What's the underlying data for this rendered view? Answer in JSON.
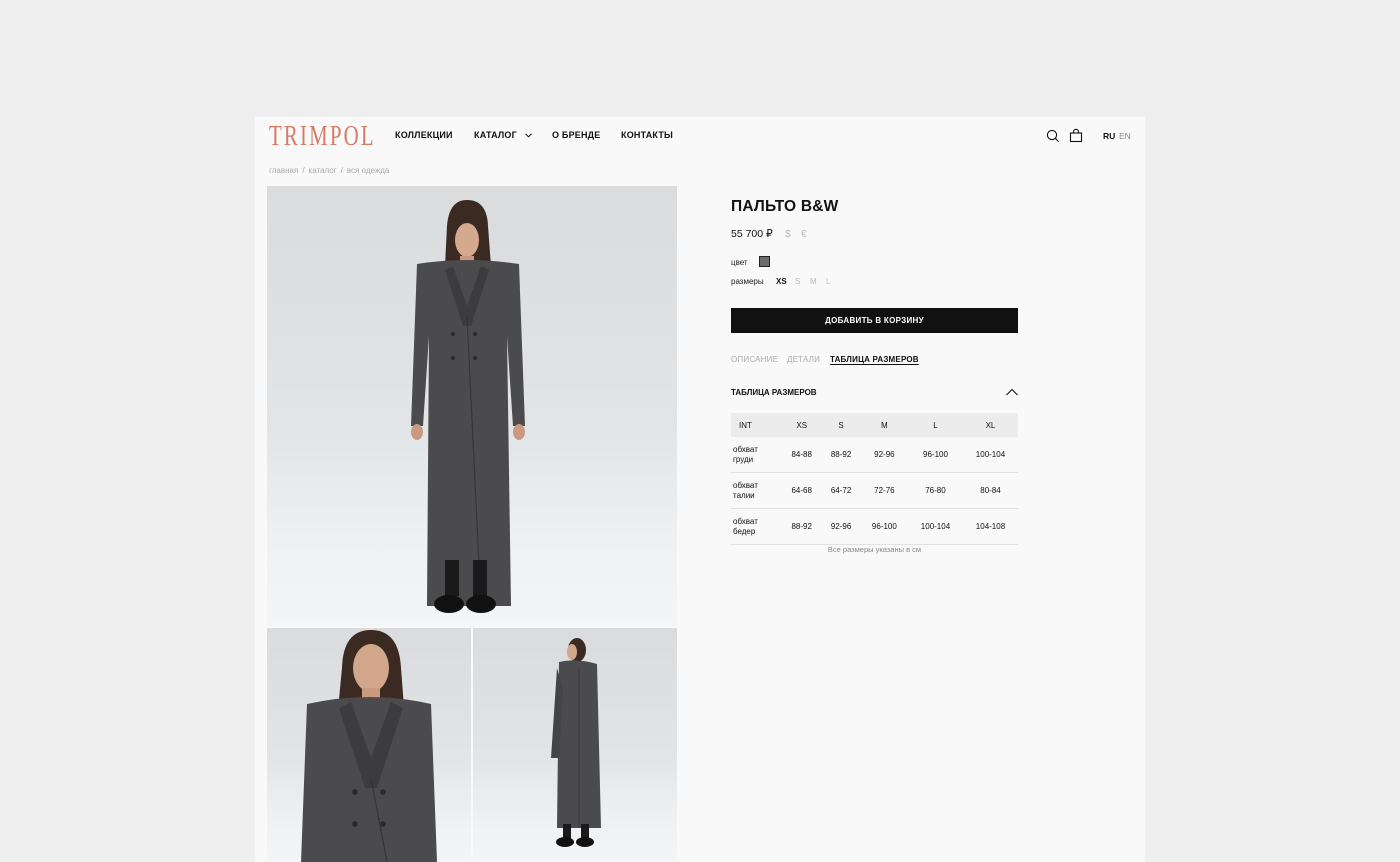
{
  "brand": {
    "logo_text": "TRIMPOL",
    "logo_color": "#d77a66"
  },
  "nav": {
    "collections": "КОЛЛЕКЦИИ",
    "catalog": "КАТАЛОГ",
    "about": "О БРЕНДЕ",
    "contacts": "КОНТАКТЫ"
  },
  "header_icons": {
    "search": "search-icon",
    "cart": "shopping-bag-icon"
  },
  "languages": {
    "ru": "RU",
    "en": "EN",
    "active": "RU"
  },
  "breadcrumb": [
    "главная",
    "каталог",
    "вся одежда"
  ],
  "product": {
    "title": "ПАЛЬТО B&W",
    "price": "55 700 ₽",
    "alt_currencies": [
      "$",
      "€"
    ],
    "color_label": "цвет",
    "color_value": "#6b6b6b",
    "sizes_label": "размеры",
    "sizes": [
      "XS",
      "S",
      "M",
      "L"
    ],
    "selected_size": "XS",
    "add_to_cart": "ДОБАВИТЬ В КОРЗИНУ"
  },
  "tabs": {
    "description": "ОПИСАНИЕ",
    "details": "ДЕТАЛИ",
    "size_chart": "ТАБЛИЦА РАЗМЕРОВ",
    "active": "ТАБЛИЦА РАЗМЕРОВ"
  },
  "size_chart": {
    "title": "ТАБЛИЦА РАЗМЕРОВ",
    "headers": [
      "INT",
      "XS",
      "S",
      "M",
      "L",
      "XL"
    ],
    "rows": [
      {
        "label_line1": "обхват",
        "label_line2": "груди",
        "values": [
          "84-88",
          "88-92",
          "92-96",
          "96-100",
          "100-104"
        ]
      },
      {
        "label_line1": "обхват",
        "label_line2": "талии",
        "values": [
          "64-68",
          "64-72",
          "72-76",
          "76-80",
          "80-84"
        ]
      },
      {
        "label_line1": "обхват",
        "label_line2": "бедер",
        "values": [
          "88-92",
          "92-96",
          "96-100",
          "100-104",
          "104-108"
        ]
      }
    ],
    "note": "Все размеры указаны в см"
  }
}
